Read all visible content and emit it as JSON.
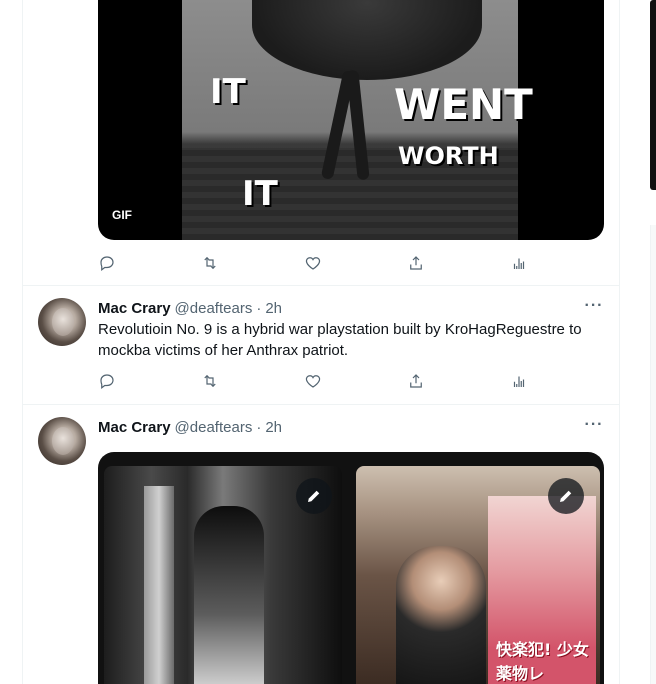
{
  "tweet1": {
    "gif_words": [
      "IT",
      "WENT",
      "WORTH",
      "IT"
    ],
    "gif_badge": "GIF"
  },
  "tweet2": {
    "name": "Mac Crary",
    "handle": "@deaftears",
    "separator": "·",
    "time": "2h",
    "text": "Revolutioin No. 9 is a hybrid war playstation built by KroHagReguestre to mockba victims of her Anthrax patriot.",
    "more": "···"
  },
  "tweet3": {
    "name": "Mac Crary",
    "handle": "@deaftears",
    "separator": "·",
    "time": "2h",
    "more": "···",
    "photo2_overlay_text": "快楽犯! 少女薬物レ"
  },
  "icons": {
    "reply": "reply-icon",
    "retweet": "retweet-icon",
    "like": "heart-icon",
    "share": "share-icon",
    "analytics": "analytics-icon",
    "edit": "pencil-icon"
  },
  "colors": {
    "text_primary": "#0f1419",
    "text_secondary": "#536471",
    "border": "#eff3f4"
  }
}
